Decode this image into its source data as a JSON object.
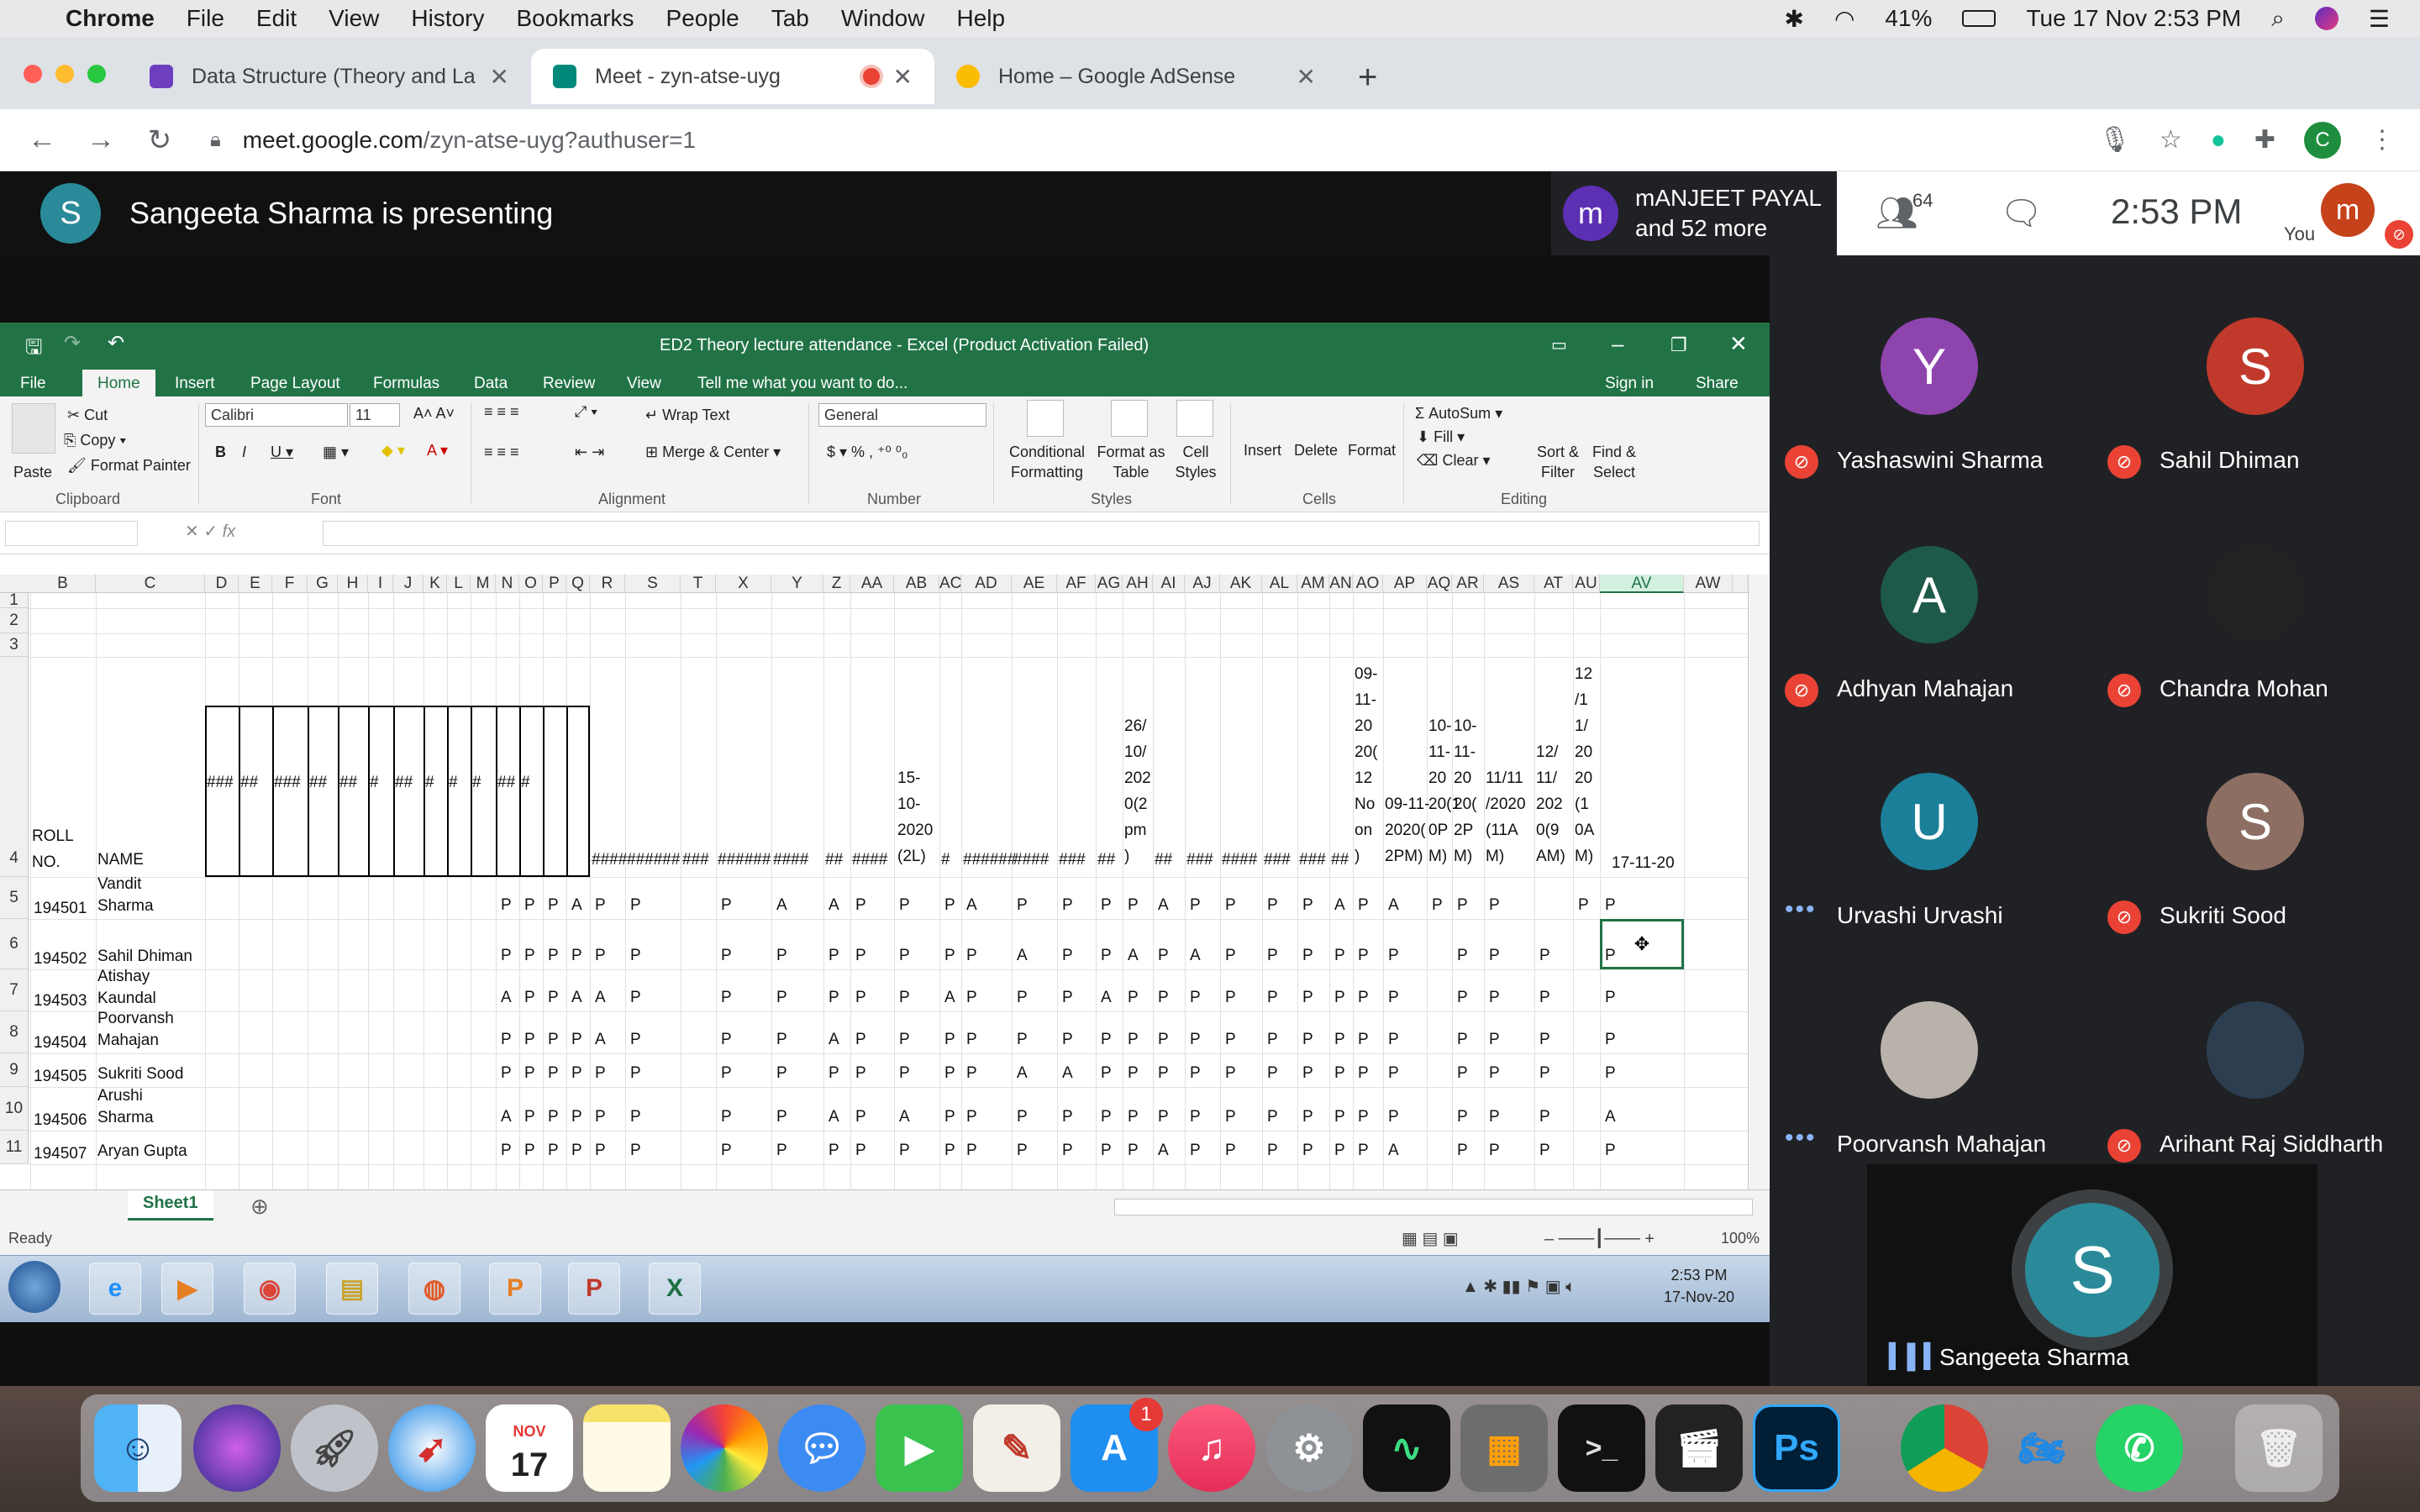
{
  "menubar": {
    "app": "Chrome",
    "items": [
      "File",
      "Edit",
      "View",
      "History",
      "Bookmarks",
      "People",
      "Tab",
      "Window",
      "Help"
    ],
    "battery": "41%",
    "datetime": "Tue 17 Nov  2:53 PM"
  },
  "tabs": [
    {
      "title": "Data Structure (Theory and Lab)"
    },
    {
      "title": "Meet - zyn-atse-uyg"
    },
    {
      "title": "Home – Google AdSense"
    }
  ],
  "omnibox": {
    "host": "meet.google.com",
    "path": "/zyn-atse-uyg?authuser=1",
    "profile": "C"
  },
  "meet": {
    "presenter_initial": "S",
    "presenting_text": "Sangeeta Sharma is presenting",
    "chip_initial": "m",
    "chip_line1": "mANJEET PAYAL",
    "chip_line2": "and 52 more",
    "people_count": "64",
    "time": "2:53 PM",
    "you_label": "You",
    "you_initial": "m",
    "participants": [
      {
        "name": "Yashaswini Sharma",
        "initial": "Y",
        "color": "#8e44ad",
        "muted": true
      },
      {
        "name": "Sahil Dhiman",
        "initial": "S",
        "color": "#c0392b",
        "muted": true
      },
      {
        "name": "Adhyan Mahajan",
        "initial": "A",
        "color": "#1e5a4a",
        "muted": true
      },
      {
        "name": "Chandra Mohan",
        "initial": "",
        "color": "#222222",
        "muted": true
      },
      {
        "name": "Urvashi Urvashi",
        "initial": "U",
        "color": "#1b7f99",
        "muted": false
      },
      {
        "name": "Sukriti Sood",
        "initial": "S",
        "color": "#8d6e63",
        "muted": true
      },
      {
        "name": "Poorvansh Mahajan",
        "initial": "",
        "color": "#b9b2aa",
        "muted": false
      },
      {
        "name": "Arihant Raj Siddharth",
        "initial": "",
        "color": "#2c3e50",
        "muted": true
      }
    ],
    "speaker": {
      "name": "Sangeeta Sharma",
      "initial": "S",
      "color": "#2a8a99"
    }
  },
  "excel": {
    "title": "ED2 Theory lecture attendance - Excel (Product Activation Failed)",
    "ribbon_tabs": [
      "File",
      "Home",
      "Insert",
      "Page Layout",
      "Formulas",
      "Data",
      "Review",
      "View",
      "Tell me what you want to do...",
      "Sign in",
      "Share"
    ],
    "clipboard": {
      "paste": "Paste",
      "cut": "Cut",
      "copy": "Copy",
      "format_painter": "Format Painter",
      "group": "Clipboard"
    },
    "font": {
      "name": "Calibri",
      "size": "11",
      "group": "Font"
    },
    "alignment": {
      "wrap": "Wrap Text",
      "merge": "Merge & Center",
      "group": "Alignment"
    },
    "number": {
      "format": "General",
      "group": "Number"
    },
    "styles": {
      "cond": "Conditional Formatting",
      "fmt_table": "Format as Table",
      "cell_styles": "Cell Styles",
      "group": "Styles"
    },
    "cells": {
      "insert": "Insert",
      "delete": "Delete",
      "format": "Format",
      "group": "Cells"
    },
    "editing": {
      "autosum": "AutoSum",
      "fill": "Fill",
      "clear": "Clear",
      "sort": "Sort & Filter",
      "find": "Find & Select",
      "group": "Editing"
    },
    "col_headers": [
      "B",
      "C",
      "D",
      "E",
      "F",
      "G",
      "H",
      "I",
      "J",
      "K",
      "L",
      "M",
      "N",
      "O",
      "P",
      "Q",
      "R",
      "S",
      "T",
      "X",
      "Y",
      "Z",
      "AA",
      "AB",
      "AC",
      "AD",
      "AE",
      "AF",
      "AG",
      "AH",
      "AI",
      "AJ",
      "AK",
      "AL",
      "AM",
      "AN",
      "AO",
      "AP",
      "AQ",
      "AR",
      "AS",
      "AT",
      "AU",
      "AV",
      "AW"
    ],
    "row_numbers": [
      "1",
      "2",
      "3",
      "4",
      "5",
      "6",
      "7",
      "8",
      "9",
      "10",
      "11"
    ],
    "header_row": {
      "roll": "ROLL\nNO.",
      "name": "NAME",
      "hash_cells": [
        "###",
        "##",
        "###",
        "##",
        "##",
        "#",
        "##",
        "#",
        "#",
        "#",
        "##",
        "#"
      ],
      "hash_row": [
        "####",
        "######",
        "###",
        "######",
        "####",
        "##",
        "####",
        "#",
        "######",
        "####",
        "###",
        "##",
        "##",
        "###",
        "####",
        "###",
        "###",
        "##"
      ],
      "ab": "15-\n10-\n2020\n(2L)",
      "ah": "26/\n10/\n202\n0(2\npm\n)",
      "ao": "09-\n11-\n20\n20(\n12\nNo\non\n)",
      "ap": "09-11-\n2020(\n2PM)",
      "aq": "10-\n11-\n20\n20(1\n0P\nM)",
      "ar": "10-\n11-\n20\n20(\n2P\nM)",
      "as": "11/11\n/2020\n(11A\nM)",
      "at": "12/\n11/\n202\n0(9\nAM)",
      "au": "12\n/1\n1/\n20\n20\n(1\n0A\nM)",
      "av": "17-11-20"
    },
    "students": [
      {
        "roll": "194501",
        "name": "Vandit\nSharma",
        "marks": [
          "P",
          "P",
          "P",
          "A",
          "P",
          "P",
          "P",
          "A",
          "A",
          "P",
          "P",
          "P",
          "A",
          "P",
          "P",
          "P",
          "P",
          "A",
          "P",
          "P",
          "P",
          "P",
          "A",
          "P",
          "A",
          "P",
          "P",
          "P",
          "",
          "P",
          "P"
        ]
      },
      {
        "roll": "194502",
        "name": "Sahil Dhiman",
        "marks": [
          "P",
          "P",
          "P",
          "P",
          "P",
          "P",
          "P",
          "P",
          "P",
          "P",
          "P",
          "P",
          "P",
          "A",
          "P",
          "P",
          "A",
          "P",
          "A",
          "P",
          "P",
          "P",
          "P",
          "P",
          "P",
          "",
          "P",
          "P",
          "P",
          "",
          "P",
          ""
        ]
      },
      {
        "roll": "194503",
        "name": "Atishay\nKaundal",
        "marks": [
          "A",
          "P",
          "P",
          "A",
          "A",
          "P",
          "P",
          "P",
          "P",
          "P",
          "P",
          "A",
          "P",
          "P",
          "P",
          "A",
          "P",
          "P",
          "P",
          "P",
          "P",
          "P",
          "P",
          "P",
          "P",
          "",
          "P",
          "P",
          "P",
          "",
          "P",
          ""
        ]
      },
      {
        "roll": "194504",
        "name": "Poorvansh\nMahajan",
        "marks": [
          "P",
          "P",
          "P",
          "P",
          "A",
          "P",
          "P",
          "P",
          "A",
          "P",
          "P",
          "P",
          "P",
          "P",
          "P",
          "P",
          "P",
          "P",
          "P",
          "P",
          "P",
          "P",
          "P",
          "P",
          "P",
          "",
          "P",
          "P",
          "P",
          "",
          "P",
          ""
        ]
      },
      {
        "roll": "194505",
        "name": "Sukriti Sood",
        "marks": [
          "P",
          "P",
          "P",
          "P",
          "P",
          "P",
          "P",
          "P",
          "P",
          "P",
          "P",
          "P",
          "P",
          "A",
          "A",
          "P",
          "P",
          "P",
          "P",
          "P",
          "P",
          "P",
          "P",
          "P",
          "P",
          "",
          "P",
          "P",
          "P",
          "",
          "P",
          ""
        ]
      },
      {
        "roll": "194506",
        "name": "Arushi\nSharma",
        "marks": [
          "A",
          "P",
          "P",
          "P",
          "P",
          "P",
          "P",
          "P",
          "A",
          "P",
          "A",
          "P",
          "P",
          "P",
          "P",
          "P",
          "P",
          "P",
          "P",
          "P",
          "P",
          "P",
          "P",
          "P",
          "P",
          "",
          "P",
          "P",
          "P",
          "",
          "A",
          ""
        ]
      },
      {
        "roll": "194507",
        "name": "Aryan Gupta",
        "marks": [
          "P",
          "P",
          "P",
          "P",
          "P",
          "P",
          "P",
          "P",
          "P",
          "P",
          "P",
          "P",
          "P",
          "P",
          "P",
          "P",
          "P",
          "A",
          "P",
          "P",
          "P",
          "P",
          "P",
          "P",
          "A",
          "",
          "P",
          "P",
          "P",
          "",
          "P",
          ""
        ]
      }
    ],
    "sheet": "Sheet1",
    "status": "Ready",
    "zoom": "100%",
    "taskbar_time": "2:53 PM",
    "taskbar_date": "17-Nov-20"
  },
  "dock": {
    "calendar_month": "NOV",
    "calendar_day": "17",
    "appstore_badge": "1",
    "ps": "Ps"
  }
}
